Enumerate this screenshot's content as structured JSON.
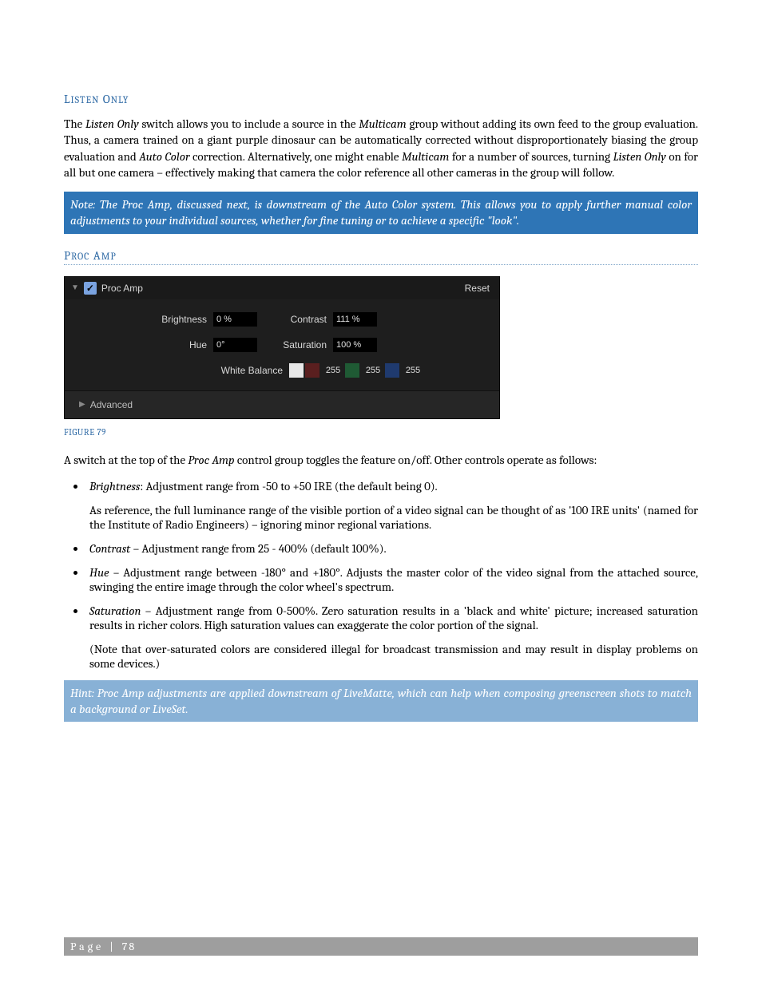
{
  "sections": {
    "listen": {
      "heading": "Listen Only",
      "para": "The Listen Only switch allows you to include a source in the Multicam group without adding its own feed to the group evaluation. Thus, a camera trained on a giant purple dinosaur can be automatically corrected without disproportionately biasing the group evaluation and Auto Color correction.  Alternatively, one might enable Multicam for a number of sources, turning Listen Only on for all but one camera – effectively making that camera the color reference all other cameras in the group will follow.",
      "note": "Note: The Proc Amp, discussed next, is downstream of the Auto Color system.  This allows you to apply further manual color adjustments to your individual sources, whether for fine tuning or to achieve a specific \"look\"."
    },
    "procamp": {
      "heading": "Proc Amp",
      "panel": {
        "title": "Proc Amp",
        "reset": "Reset",
        "brightness_label": "Brightness",
        "brightness_value": "0  %",
        "contrast_label": "Contrast",
        "contrast_value": "111  %",
        "hue_label": "Hue",
        "hue_value": "0°",
        "saturation_label": "Saturation",
        "saturation_value": "100  %",
        "wb_label": "White Balance",
        "wb_r": "255",
        "wb_g": "255",
        "wb_b": "255",
        "advanced": "Advanced"
      },
      "figure": "FIGURE 79",
      "intro": "A switch at the top of the Proc Amp control group toggles the feature on/off.  Other controls operate as follows:",
      "bullets": {
        "brightness_main": "Brightness: Adjustment range from -50 to +50 IRE (the default being 0).",
        "brightness_sub": "As reference, the full luminance range of the visible portion of a video signal can be thought of as '100 IRE units' (named for the Institute of Radio Engineers) – ignoring minor regional variations.",
        "contrast": "Contrast – Adjustment range from 25 - 400% (default 100%).",
        "hue": "Hue – Adjustment range between -180° and +180°.  Adjusts the master color of the video signal from the attached source, swinging the entire image through the color wheel's spectrum.",
        "saturation_main": "Saturation – Adjustment range from 0-500%.  Zero saturation results in a 'black and white' picture; increased saturation results in richer colors.  High saturation values can exaggerate the color portion of the signal.",
        "saturation_sub": "(Note that over-saturated colors are considered illegal for broadcast transmission and may result in display problems on some devices.)"
      },
      "hint": "Hint: Proc Amp adjustments are applied downstream of LiveMatte, which can help when composing greenscreen shots to match a background or LiveSet."
    }
  },
  "footer": {
    "label": "Page | ",
    "number": "78"
  }
}
